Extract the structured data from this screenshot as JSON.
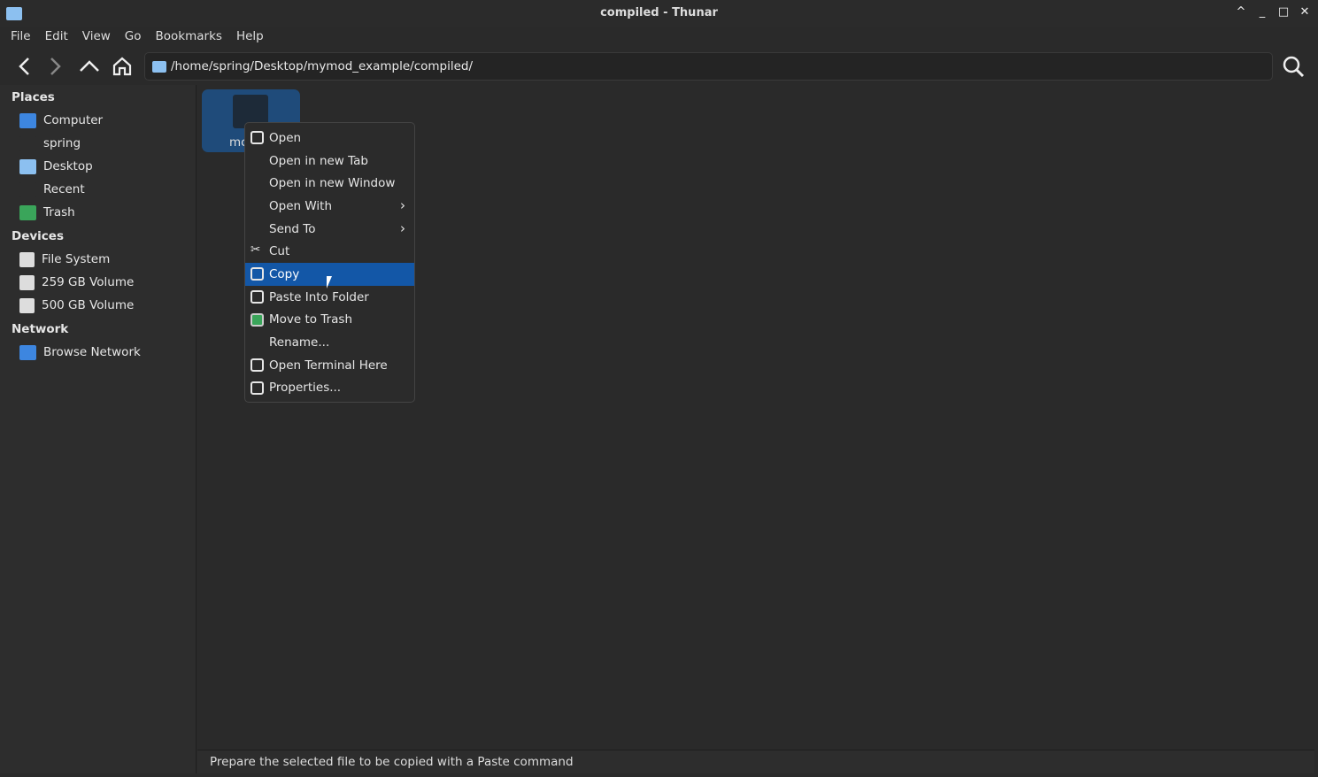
{
  "window": {
    "title": "compiled - Thunar"
  },
  "menubar": [
    "File",
    "Edit",
    "View",
    "Go",
    "Bookmarks",
    "Help"
  ],
  "location": {
    "path": "/home/spring/Desktop/mymod_example/compiled/"
  },
  "sidebar": {
    "places_label": "Places",
    "places": [
      {
        "label": "Computer",
        "icon": "computer-icon",
        "color": "#3d86e0"
      },
      {
        "label": "spring",
        "icon": "home-folder-icon",
        "color": "#2d2d2d"
      },
      {
        "label": "Desktop",
        "icon": "desktop-folder-icon",
        "color": "#8cc0f0"
      },
      {
        "label": "Recent",
        "icon": "recent-icon",
        "color": "#2d2d2d"
      },
      {
        "label": "Trash",
        "icon": "trash-icon",
        "color": "#3aa55a"
      }
    ],
    "devices_label": "Devices",
    "devices": [
      {
        "label": "File System"
      },
      {
        "label": "259 GB Volume"
      },
      {
        "label": "500 GB Volume"
      }
    ],
    "network_label": "Network",
    "network": [
      {
        "label": "Browse Network"
      }
    ]
  },
  "file": {
    "name": "mc"
  },
  "context_menu": [
    {
      "label": "Open",
      "icon": "folder-open-icon"
    },
    {
      "label": "Open in new Tab"
    },
    {
      "label": "Open in new Window"
    },
    {
      "label": "Open With",
      "submenu": true
    },
    {
      "label": "Send To",
      "submenu": true
    },
    {
      "label": "Cut",
      "icon": "scissors-icon"
    },
    {
      "label": "Copy",
      "icon": "copy-icon",
      "highlighted": true
    },
    {
      "label": "Paste Into Folder",
      "icon": "clipboard-icon"
    },
    {
      "label": "Move to Trash",
      "icon": "trash-icon"
    },
    {
      "label": "Rename..."
    },
    {
      "label": "Open Terminal Here",
      "icon": "terminal-icon"
    },
    {
      "label": "Properties...",
      "icon": "properties-icon"
    }
  ],
  "status": "Prepare the selected file to be copied with a Paste command",
  "colors": {
    "accent": "#1357a7"
  }
}
